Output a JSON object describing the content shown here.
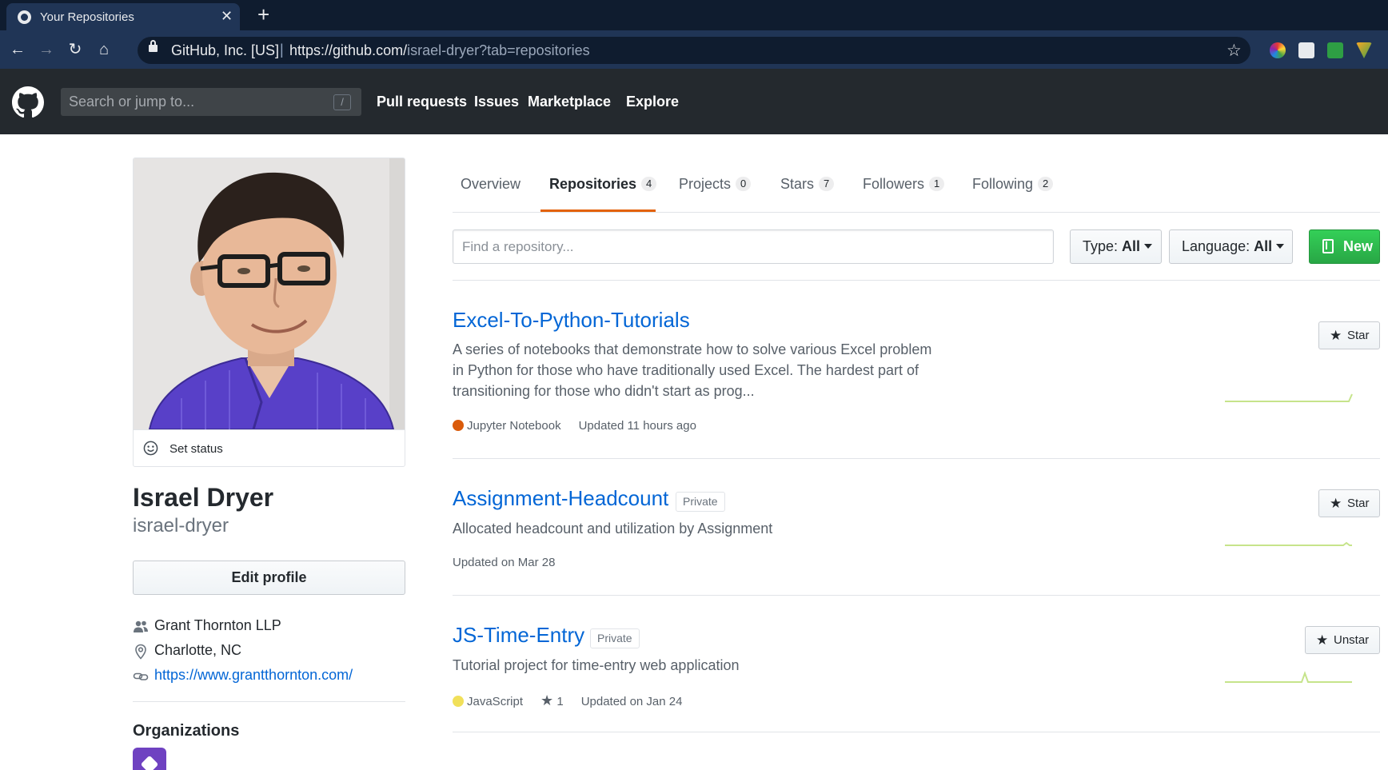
{
  "browser": {
    "tab_title": "Your Repositories",
    "cert_org": "GitHub, Inc. [US]",
    "url_host": "https://github.com/",
    "url_path": "israel-dryer?tab=repositories"
  },
  "header": {
    "search_placeholder": "Search or jump to...",
    "slash_key": "/",
    "nav": [
      "Pull requests",
      "Issues",
      "Marketplace",
      "Explore"
    ]
  },
  "profile": {
    "set_status": "Set status",
    "name": "Israel Dryer",
    "login": "israel-dryer",
    "edit_profile": "Edit profile",
    "company": "Grant Thornton LLP",
    "location": "Charlotte, NC",
    "website": "https://www.grantthornton.com/",
    "organizations_heading": "Organizations"
  },
  "tabs": [
    {
      "label": "Overview",
      "count": null
    },
    {
      "label": "Repositories",
      "count": "4"
    },
    {
      "label": "Projects",
      "count": "0"
    },
    {
      "label": "Stars",
      "count": "7"
    },
    {
      "label": "Followers",
      "count": "1"
    },
    {
      "label": "Following",
      "count": "2"
    }
  ],
  "filters": {
    "find_placeholder": "Find a repository...",
    "type_prefix": "Type:",
    "type_value": "All",
    "language_prefix": "Language:",
    "language_value": "All",
    "new_label": "New"
  },
  "repos": [
    {
      "name": "Excel-To-Python-Tutorials",
      "private": "",
      "description": "A series of notebooks that demonstrate how to solve various Excel problem in Python for those who have traditionally used Excel. The hardest part of transitioning for those who didn't start as prog...",
      "language": "Jupyter Notebook",
      "language_color": "#DA5B0B",
      "stars": "",
      "updated": "Updated 11 hours ago",
      "star_button": "Star"
    },
    {
      "name": "Assignment-Headcount",
      "private": "Private",
      "description": "Allocated headcount and utilization by Assignment",
      "language": "",
      "language_color": "",
      "stars": "",
      "updated": "Updated on Mar 28",
      "star_button": "Star"
    },
    {
      "name": "JS-Time-Entry",
      "private": "Private",
      "description": "Tutorial project for time-entry web application",
      "language": "JavaScript",
      "language_color": "#F1E05A",
      "stars": "1",
      "updated": "Updated on Jan 24",
      "star_button": "Unstar"
    }
  ],
  "colors": {
    "link": "#0366d6",
    "tab_accent": "#e36209",
    "new_button": "#28a745",
    "sparkline": "#c6e48b"
  }
}
